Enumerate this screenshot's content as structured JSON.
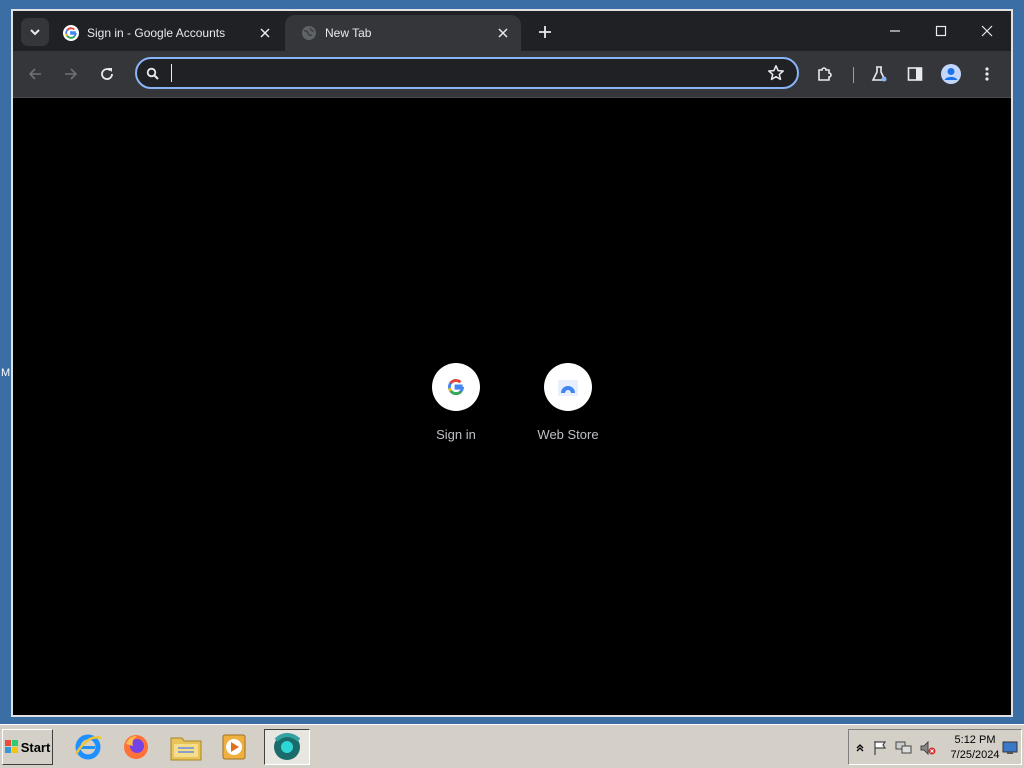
{
  "desktop": {
    "edge_letter": "M"
  },
  "browser": {
    "tabs": [
      {
        "title": "Sign in - Google Accounts",
        "favicon": "google-g-icon",
        "active": false
      },
      {
        "title": "New Tab",
        "favicon": "globe-icon",
        "active": true
      }
    ],
    "omnibox": {
      "value": "",
      "placeholder": ""
    },
    "colors": {
      "frame": "#202124",
      "toolbar": "#35363a",
      "accent": "#8ab4f8",
      "page_bg": "#000000"
    }
  },
  "new_tab_page": {
    "shortcuts": [
      {
        "label": "Sign in",
        "icon": "google-g-icon"
      },
      {
        "label": "Web Store",
        "icon": "web-store-icon"
      }
    ]
  },
  "taskbar": {
    "start_label": "Start",
    "pinned": [
      "internet-explorer-icon",
      "firefox-icon",
      "file-explorer-icon",
      "media-player-icon",
      "chrome-dev-icon"
    ],
    "clock": {
      "time": "5:12 PM",
      "date": "7/25/2024"
    }
  }
}
